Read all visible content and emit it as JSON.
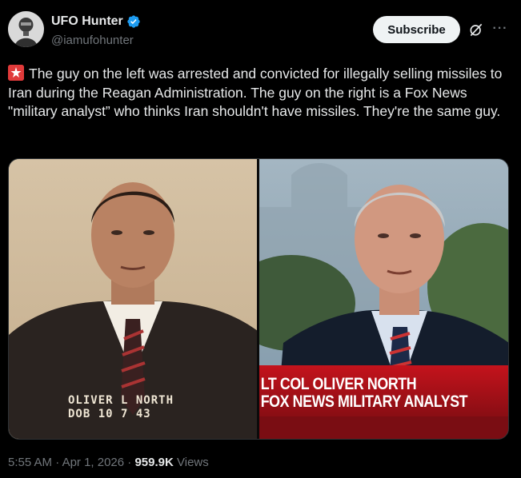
{
  "author": {
    "name": "UFO Hunter",
    "handle": "@iamufohunter",
    "verified": true,
    "avatar_icon": "soldier-avatar-icon"
  },
  "actions": {
    "subscribe_label": "Subscribe",
    "grok_icon": "grok-icon",
    "more_icon": "more-dots-icon"
  },
  "tweet": {
    "emoji": "siren-emoji",
    "text": "The guy on the left was arrested and convicted for illegally selling missiles to Iran during the Reagan Administration. The guy on the right is a Fox News \"military analyst” who thinks Iran shouldn't have missiles. They're the same guy."
  },
  "media": {
    "left": {
      "label_line1": "OLIVER L NORTH",
      "label_line2": "DOB 10 7 43"
    },
    "right": {
      "chyron_line1": "LT COL OLIVER NORTH",
      "chyron_line2": "FOX NEWS MILITARY ANALYST"
    }
  },
  "meta": {
    "time": "5:55 AM",
    "date": "Apr 1, 2026",
    "views_count": "959.9K",
    "views_label": "Views",
    "separator": "·"
  },
  "colors": {
    "background": "#000000",
    "text": "#e7e9ea",
    "secondary": "#71767b",
    "verified": "#1d9bf0",
    "subscribe_bg": "#eff3f4",
    "chyron_red": "#b3121b"
  }
}
